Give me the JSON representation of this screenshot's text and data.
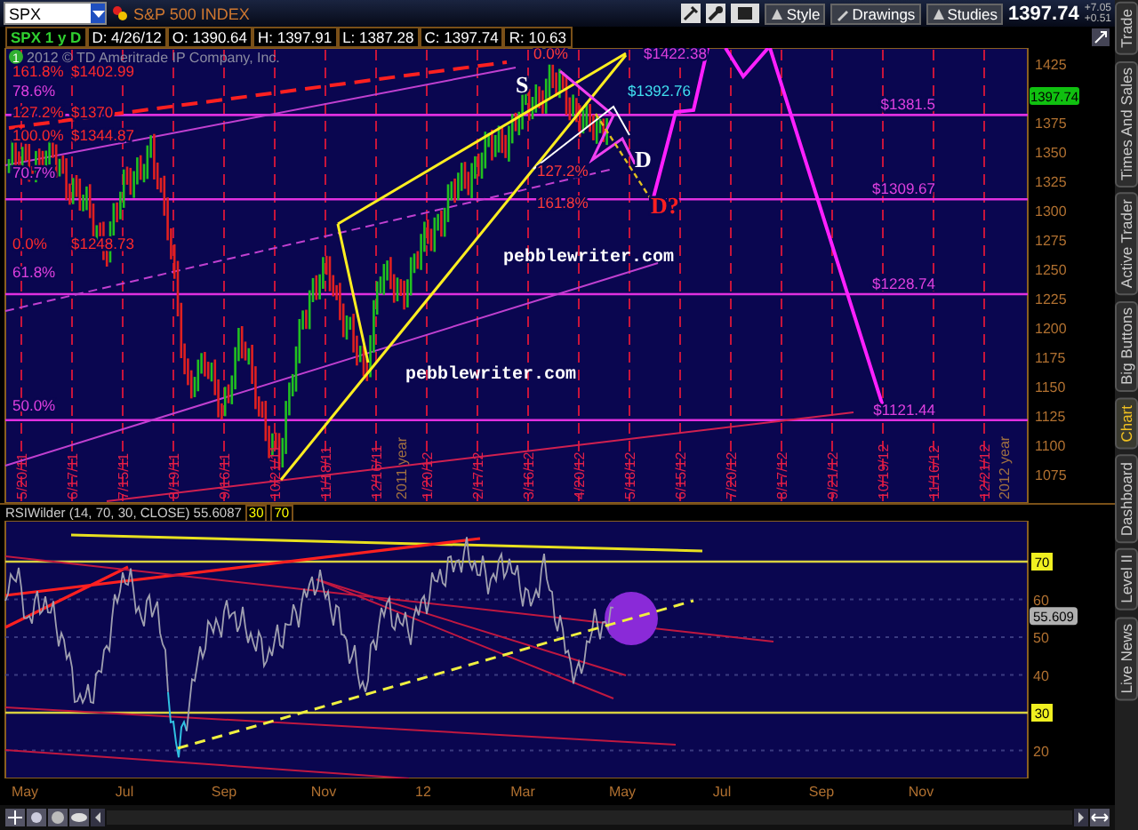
{
  "toolbar": {
    "symbol": "SPX",
    "title": "S&P 500 INDEX",
    "buttons": [
      "Style",
      "Drawings",
      "Studies"
    ],
    "last": "1397.74",
    "change": "+7.05",
    "change_pct": "+0.51"
  },
  "info_bar": {
    "study": "SPX 1 y D",
    "fields": [
      "D: 4/26/12",
      "O: 1390.64",
      "H: 1397.91",
      "L: 1387.28",
      "C: 1397.74",
      "R: 10.63"
    ]
  },
  "price_chart": {
    "copyright_badge": "1",
    "copyright": "2012 © TD Ameritrade IP Company, Inc.",
    "fib_left": [
      {
        "percent": "161.8%",
        "price": "$1402.99",
        "color": "#ff2a2a"
      },
      {
        "percent": "78.6%",
        "color": "#e040e0"
      },
      {
        "percent": "127.2%",
        "price": "$1370",
        "color": "#ff2a2a"
      },
      {
        "percent": "100.0%",
        "price": "$1344.87",
        "color": "#ff2a2a"
      },
      {
        "percent": "70.7%",
        "color": "#e040e0"
      },
      {
        "percent": "0.0%",
        "price": "$1248.73",
        "color": "#ff2a2a"
      },
      {
        "percent": "61.8%",
        "color": "#e040e0"
      },
      {
        "percent": "50.0%",
        "color": "#e040e0"
      }
    ],
    "pattern_labels": [
      {
        "text": "0.0%",
        "kind": "percent"
      },
      {
        "text": "$1422.38",
        "kind": "price"
      },
      {
        "text": "$1392.76",
        "kind": "quote"
      },
      {
        "text": "127.2%",
        "kind": "percent"
      },
      {
        "text": "161.8%",
        "kind": "percent"
      }
    ],
    "level_prices": [
      "$1381.5",
      "$1309.67",
      "$1228.74",
      "$1121.44"
    ],
    "points": [
      {
        "text": "S",
        "kind": "point"
      },
      {
        "text": "D",
        "kind": "point"
      },
      {
        "text": "D?",
        "kind": "projected"
      }
    ],
    "watermarks": [
      "pebblewriter.com",
      "pebblewriter.com"
    ],
    "date_labels": [
      "5/20/11",
      "6/17/11",
      "7/15/11",
      "8/19/11",
      "9/16/11",
      "10/21/11",
      "11/18/11",
      "12/16/11",
      "1/20/12",
      "2/17/12",
      "3/16/12",
      "4/20/12",
      "5/18/12",
      "6/15/12",
      "7/20/12",
      "8/17/12",
      "9/21/12",
      "10/19/12",
      "11/16/12",
      "12/21/12"
    ],
    "year_labels": [
      "2011 year",
      "2012 year"
    ],
    "price_ticks": [
      "1425",
      "1375",
      "1350",
      "1325",
      "1300",
      "1275",
      "1250",
      "1225",
      "1200",
      "1175",
      "1150",
      "1125",
      "1100",
      "1075"
    ],
    "last_price": "1397.74"
  },
  "rsi": {
    "title": "RSIWilder (14, 70, 30, CLOSE)",
    "value": "55.6087",
    "levels": [
      "30",
      "70"
    ],
    "ticks": [
      {
        "label": "70",
        "highlighted": true
      },
      {
        "label": "60",
        "highlighted": false
      },
      {
        "label": "50",
        "highlighted": false
      },
      {
        "label": "40",
        "highlighted": false
      },
      {
        "label": "30",
        "highlighted": true
      },
      {
        "label": "20",
        "highlighted": false
      }
    ],
    "last_value": "55.609"
  },
  "months": [
    "May",
    "Jul",
    "Sep",
    "Nov",
    "12",
    "Mar",
    "May",
    "Jul",
    "Sep",
    "Nov"
  ],
  "side_tabs": [
    {
      "label": "Trade",
      "selected": false
    },
    {
      "label": "Times And Sales",
      "selected": false
    },
    {
      "label": "Active Trader",
      "selected": false
    },
    {
      "label": "Big Buttons",
      "selected": false
    },
    {
      "label": "Chart",
      "selected": true
    },
    {
      "label": "Dashboard",
      "selected": false
    },
    {
      "label": "Level II",
      "selected": false
    },
    {
      "label": "Live News",
      "selected": false
    }
  ]
}
